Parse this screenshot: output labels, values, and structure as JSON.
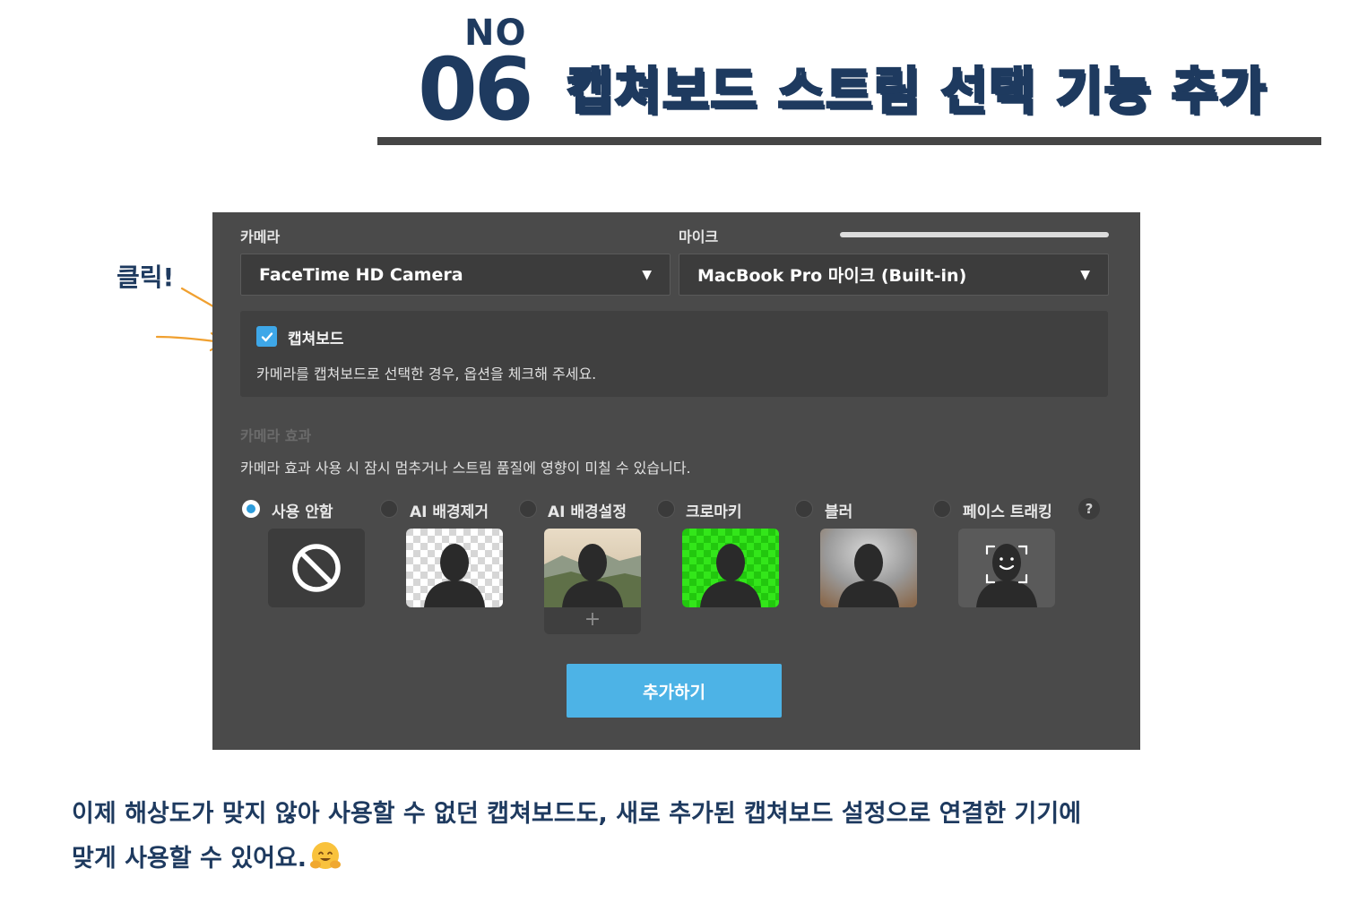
{
  "header": {
    "no_label": "NO",
    "number": "06",
    "title": "캡쳐보드 스트림 선택 기능 추가"
  },
  "annotation": {
    "click_label": "클릭!",
    "accent_color": "#f0a030"
  },
  "panel": {
    "camera": {
      "label": "카메라",
      "value": "FaceTime HD Camera"
    },
    "mic": {
      "label": "마이크",
      "value": "MacBook Pro 마이크 (Built-in)"
    },
    "capture_board": {
      "checked": true,
      "label": "캡쳐보드",
      "description": "카메라를 캡쳐보드로 선택한 경우, 옵션을 체크해 주세요."
    },
    "effects": {
      "label": "카메라 효과",
      "description": "카메라 효과 사용 시 잠시 멈추거나 스트림 품질에 영향이 미칠 수 있습니다.",
      "options": [
        {
          "label": "사용 안함",
          "selected": true,
          "icon": "ban-icon"
        },
        {
          "label": "AI 배경제거",
          "selected": false,
          "icon": "person-transparent-bg-icon"
        },
        {
          "label": "AI 배경설정",
          "selected": false,
          "icon": "person-landscape-bg-icon"
        },
        {
          "label": "크로마키",
          "selected": false,
          "icon": "person-greenscreen-icon"
        },
        {
          "label": "블러",
          "selected": false,
          "icon": "person-blur-bg-icon"
        },
        {
          "label": "페이스 트래킹",
          "selected": false,
          "icon": "face-tracking-icon"
        }
      ],
      "help": "?",
      "add_strip": "+"
    },
    "add_button": "추가하기"
  },
  "footer": {
    "line1": "이제 해상도가 맞지 않아 사용할 수 없던 캡쳐보드도, 새로 추가된 캡쳐보드 설정으로 연결한 기기에",
    "line2": "맞게 사용할 수 있어요."
  },
  "colors": {
    "navy": "#1e3a5f",
    "accent_blue": "#4db3e6",
    "panel_bg": "#4a4a4a",
    "chroma_green": "#33e61a"
  }
}
